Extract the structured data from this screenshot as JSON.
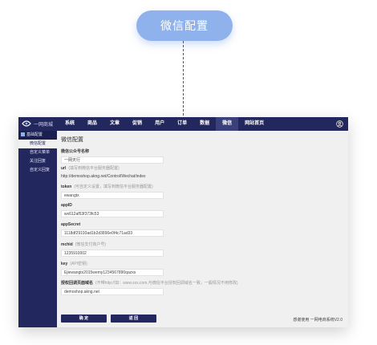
{
  "callout": {
    "label": "微信配置"
  },
  "app": {
    "logo_text": "一网商城",
    "nav": [
      "系统",
      "商品",
      "文章",
      "促销",
      "用户",
      "订单",
      "数据",
      "微信",
      "网站首页"
    ],
    "nav_active_index": 7,
    "sidebar": {
      "header": "基础配置",
      "items": [
        "微信配置",
        "自定义菜单",
        "关注回复",
        "自定义回复"
      ],
      "active_index": 0
    },
    "page_title": "微信配置",
    "fields": {
      "name": {
        "label": "微信公众号名称",
        "value": "一网天行"
      },
      "url": {
        "label": "url",
        "hint": "(填写到微信平台服务器配置)",
        "value": "http://demoshop.akng.net/Control/Wechat/index"
      },
      "token": {
        "label": "token",
        "hint": "(可自定义设置，填写到微信平台服务器配置)",
        "value": "ewangtx"
      },
      "appid": {
        "label": "appID",
        "value": "wx612af53f373fc53"
      },
      "appsecret": {
        "label": "appSecret",
        "value": "1118df29193ad1b2d3890e0f4c71ad33"
      },
      "mchid": {
        "label": "mchid",
        "hint": "(微信支付商户号)",
        "value": "1235910002"
      },
      "key": {
        "label": "key",
        "hint": "(API密钥)",
        "value": "Ejiewangtx2015wemy1234567890qazxs"
      },
      "domain": {
        "label": "授权回调页面域名",
        "hint": "(不带http://如：www.xxx.com,与微信平台授权回调域名一致，一般情况不用修改)",
        "value": "demoshop.akng.net"
      }
    },
    "buttons": {
      "save": "确 定",
      "back": "返 回"
    },
    "footer": "感谢使用 一网电商系统V2.0"
  }
}
